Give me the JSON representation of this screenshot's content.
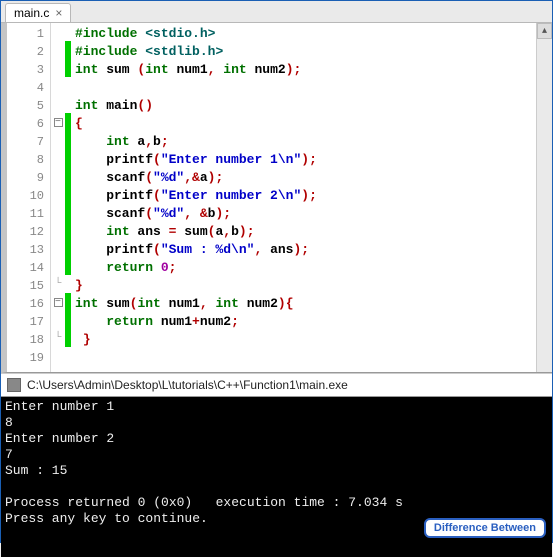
{
  "tab": {
    "label": "main.c",
    "close": "×"
  },
  "code": {
    "lines": [
      {
        "n": 1,
        "chg": false,
        "fold": "",
        "html": "<span class='kw'>#include</span> <span class='pp'>&lt;stdio.h&gt;</span>"
      },
      {
        "n": 2,
        "chg": true,
        "fold": "",
        "html": "<span class='kw'>#include</span> <span class='pp'>&lt;stdlib.h&gt;</span>"
      },
      {
        "n": 3,
        "chg": true,
        "fold": "",
        "html": "<span class='kw'>int</span> sum <span class='red'>(</span><span class='kw'>int</span> num1<span class='red'>,</span> <span class='kw'>int</span> num2<span class='red'>);</span>"
      },
      {
        "n": 4,
        "chg": false,
        "fold": "",
        "html": ""
      },
      {
        "n": 5,
        "chg": false,
        "fold": "",
        "html": "<span class='kw'>int</span> main<span class='red'>()</span>"
      },
      {
        "n": 6,
        "chg": true,
        "fold": "minus",
        "html": "<span class='red'>{</span>"
      },
      {
        "n": 7,
        "chg": true,
        "fold": "",
        "html": "    <span class='kw'>int</span> a<span class='red'>,</span>b<span class='red'>;</span>"
      },
      {
        "n": 8,
        "chg": true,
        "fold": "",
        "html": "    printf<span class='red'>(</span><span class='str'>\"Enter number 1\\n\"</span><span class='red'>);</span>"
      },
      {
        "n": 9,
        "chg": true,
        "fold": "",
        "html": "    scanf<span class='red'>(</span><span class='str'>\"%d\"</span><span class='red'>,&amp;</span>a<span class='red'>);</span>"
      },
      {
        "n": 10,
        "chg": true,
        "fold": "",
        "html": "    printf<span class='red'>(</span><span class='str'>\"Enter number 2\\n\"</span><span class='red'>);</span>"
      },
      {
        "n": 11,
        "chg": true,
        "fold": "",
        "html": "    scanf<span class='red'>(</span><span class='str'>\"%d\"</span><span class='red'>, &amp;</span>b<span class='red'>);</span>"
      },
      {
        "n": 12,
        "chg": true,
        "fold": "",
        "html": "    <span class='kw'>int</span> ans <span class='red'>=</span> sum<span class='red'>(</span>a<span class='red'>,</span>b<span class='red'>);</span>"
      },
      {
        "n": 13,
        "chg": true,
        "fold": "",
        "html": "    printf<span class='red'>(</span><span class='str'>\"Sum : %d\\n\"</span><span class='red'>,</span> ans<span class='red'>);</span>"
      },
      {
        "n": 14,
        "chg": true,
        "fold": "",
        "html": "    <span class='kw'>return</span> <span class='num'>0</span><span class='red'>;</span>"
      },
      {
        "n": 15,
        "chg": false,
        "fold": "end",
        "html": "<span class='red'>}</span>"
      },
      {
        "n": 16,
        "chg": true,
        "fold": "minus",
        "html": "<span class='kw'>int</span> sum<span class='red'>(</span><span class='kw'>int</span> num1<span class='red'>,</span> <span class='kw'>int</span> num2<span class='red'>){</span>"
      },
      {
        "n": 17,
        "chg": true,
        "fold": "",
        "html": "    <span class='kw'>return</span> num1<span class='red'>+</span>num2<span class='red'>;</span>"
      },
      {
        "n": 18,
        "chg": true,
        "fold": "end",
        "html": " <span class='red'>}</span>"
      },
      {
        "n": 19,
        "chg": false,
        "fold": "",
        "html": ""
      }
    ]
  },
  "console": {
    "title_path": "C:\\Users\\Admin\\Desktop\\L\\tutorials\\C++\\Function1\\main.exe",
    "lines": [
      "Enter number 1",
      "8",
      "Enter number 2",
      "7",
      "Sum : 15",
      "",
      "Process returned 0 (0x0)   execution time : 7.034 s",
      "Press any key to continue."
    ]
  },
  "watermark": "Difference Between"
}
